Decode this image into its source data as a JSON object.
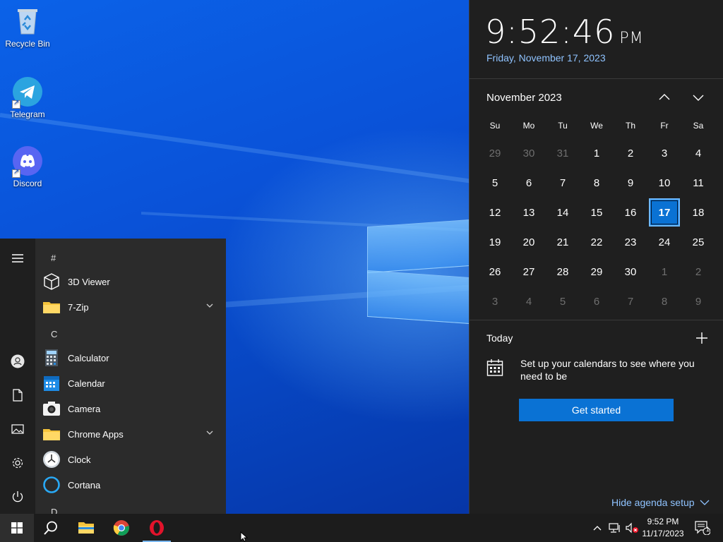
{
  "desktop": {
    "icons": [
      {
        "label": "Recycle Bin"
      },
      {
        "label": "Telegram"
      },
      {
        "label": "Discord"
      }
    ]
  },
  "start_menu": {
    "sections": {
      "hash": "#",
      "c": "C",
      "d": "D"
    },
    "apps": {
      "viewer3d": "3D Viewer",
      "zip7": "7-Zip",
      "calculator": "Calculator",
      "calendar": "Calendar",
      "camera": "Camera",
      "chrome_apps": "Chrome Apps",
      "clock": "Clock",
      "cortana": "Cortana"
    }
  },
  "clock_flyout": {
    "time": "9:52:46",
    "ampm": "PM",
    "date": "Friday, November 17, 2023",
    "month_title": "November 2023",
    "weekdays": [
      "Su",
      "Mo",
      "Tu",
      "We",
      "Th",
      "Fr",
      "Sa"
    ],
    "weeks": [
      [
        "29",
        "30",
        "31",
        "1",
        "2",
        "3",
        "4"
      ],
      [
        "5",
        "6",
        "7",
        "8",
        "9",
        "10",
        "11"
      ],
      [
        "12",
        "13",
        "14",
        "15",
        "16",
        "17",
        "18"
      ],
      [
        "19",
        "20",
        "21",
        "22",
        "23",
        "24",
        "25"
      ],
      [
        "26",
        "27",
        "28",
        "29",
        "30",
        "1",
        "2"
      ],
      [
        "3",
        "4",
        "5",
        "6",
        "7",
        "8",
        "9"
      ]
    ],
    "today_label": "Today",
    "agenda_message": "Set up your calendars to see where you need to be",
    "get_started": "Get started",
    "hide_agenda": "Hide agenda setup"
  },
  "taskbar": {
    "clock_time": "9:52 PM",
    "clock_date": "11/17/2023",
    "notification_count": "1"
  },
  "colors": {
    "accent": "#0a72d4",
    "link": "#8fc3ff",
    "flyout_bg": "#1f1f1f",
    "start_bg": "#2b2b2b",
    "taskbar_bg": "#1c1c1c"
  }
}
